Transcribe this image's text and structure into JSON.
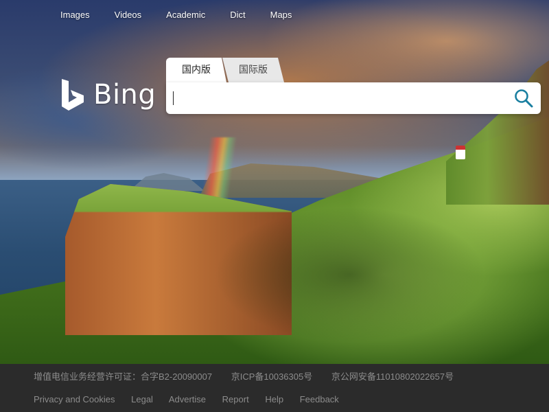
{
  "topnav": {
    "items": [
      "Images",
      "Videos",
      "Academic",
      "Dict",
      "Maps"
    ]
  },
  "logo": {
    "text": "Bing",
    "icon": "bing-b-icon"
  },
  "tabs": [
    {
      "label": "国内版",
      "active": true
    },
    {
      "label": "国际版",
      "active": false
    }
  ],
  "search": {
    "value": "",
    "placeholder": "",
    "button_icon": "search-icon",
    "accent": "#1a7fa0"
  },
  "footer": {
    "licenses": [
      "增值电信业务经营许可证：合字B2-20090007",
      "京ICP备10036305号",
      "京公网安备11010802022657号"
    ],
    "links": [
      "Privacy and Cookies",
      "Legal",
      "Advertise",
      "Report",
      "Help",
      "Feedback"
    ]
  },
  "colors": {
    "footer_bg": "#2b2b2b",
    "footer_text": "#8c8c8c"
  }
}
